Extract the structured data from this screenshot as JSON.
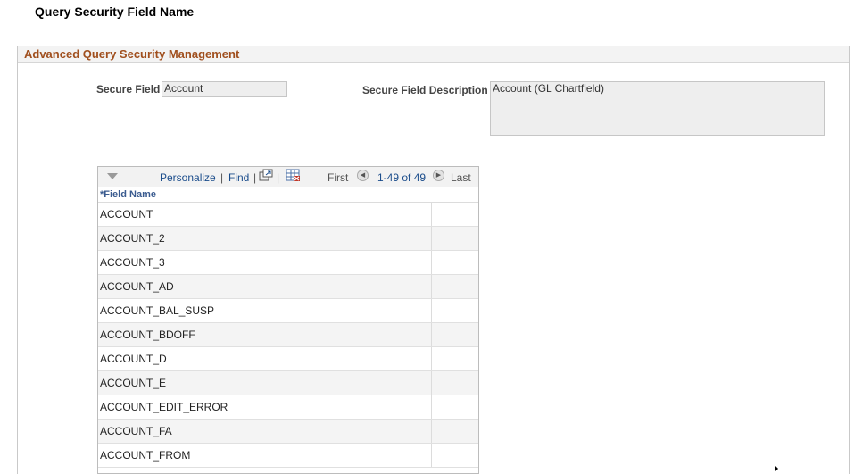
{
  "page": {
    "title": "Query Security Field Name"
  },
  "section": {
    "title": "Advanced Query Security Management"
  },
  "form": {
    "secure_field_label": "Secure Field",
    "secure_field_value": "Account",
    "secure_field_desc_label": "Secure Field Description",
    "secure_field_desc_value": "Account (GL Chartfield)"
  },
  "grid": {
    "personalize": "Personalize",
    "find": "Find",
    "sep": "|",
    "first": "First",
    "range": "1-49 of 49",
    "last": "Last",
    "column_header": "*Field Name",
    "rows": [
      "ACCOUNT",
      "ACCOUNT_2",
      "ACCOUNT_3",
      "ACCOUNT_AD",
      "ACCOUNT_BAL_SUSP",
      "ACCOUNT_BDOFF",
      "ACCOUNT_D",
      "ACCOUNT_E",
      "ACCOUNT_EDIT_ERROR",
      "ACCOUNT_FA",
      "ACCOUNT_FROM"
    ]
  },
  "icons": {
    "collapse": "chevron-down-icon",
    "new_window": "new-window-icon",
    "download": "grid-download-icon",
    "prev": "previous-arrow-icon",
    "next": "next-arrow-icon"
  },
  "colors": {
    "section_title": "#a04f1e",
    "link": "#1a4c8b",
    "field_bg": "#eeeeee"
  }
}
